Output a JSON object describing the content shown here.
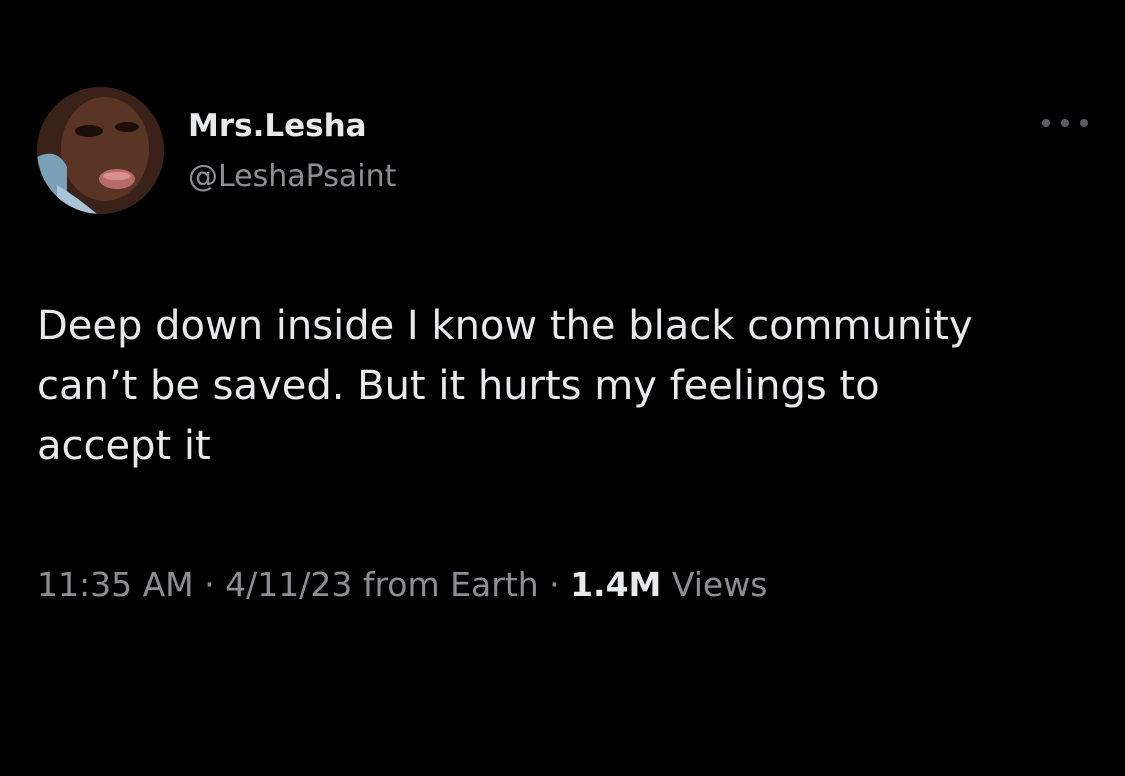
{
  "tweet": {
    "display_name": "Mrs.Lesha",
    "handle": "@LeshaPsaint",
    "text": "Deep down inside I know the black community\ncan’t be saved. But it hurts my feelings to\naccept it",
    "time": "11:35 AM",
    "separator": " · ",
    "date_source": "4/11/23 from Earth",
    "views_count": "1.4M",
    "views_label": " Views",
    "more_icon": "more-horizontal-icon",
    "avatar_icon": "avatar"
  },
  "colors": {
    "background": "#000000",
    "primary_text": "#e7e9ea",
    "secondary_text": "#8b8f94"
  }
}
